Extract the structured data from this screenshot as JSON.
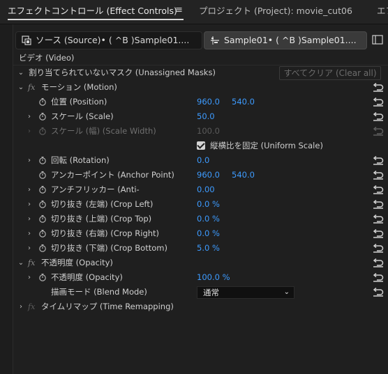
{
  "tabs": {
    "effect_controls": "エフェクトコントロール (Effect Controls)",
    "menu_icon": "≡",
    "project": "プロジェクト (Project): movie_cut06",
    "cut": "エフ"
  },
  "source_bar": {
    "source": "ソース (Source)•  ( ^B )Sample01....",
    "sequence": "Sample01•  ( ^B )Sample01...."
  },
  "section_video": "ビデオ (Video)",
  "unassigned_masks": {
    "label": "割り当てられていないマスク (Unassigned Masks)",
    "clear_all": "すべてクリア (Clear all)"
  },
  "motion": {
    "label": "モーション (Motion)",
    "fx": "fx",
    "position": {
      "label": "位置 (Position)",
      "x": "960.0",
      "y": "540.0"
    },
    "scale": {
      "label": "スケール (Scale)",
      "value": "50.0"
    },
    "scale_width": {
      "label": "スケール (幅) (Scale Width)",
      "value": "100.0"
    },
    "uniform_scale": {
      "label": "縦横比を固定 (Uniform Scale)",
      "checked": true
    },
    "rotation": {
      "label": "回転 (Rotation)",
      "value": "0.0"
    },
    "anchor_point": {
      "label": "アンカーポイント (Anchor Point)",
      "x": "960.0",
      "y": "540.0"
    },
    "anti_flicker": {
      "label": "アンチフリッカー (Anti-",
      "value": "0.00"
    },
    "crop_left": {
      "label": "切り抜き (左端) (Crop Left)",
      "value": "0.0 %"
    },
    "crop_top": {
      "label": "切り抜き (上端) (Crop Top)",
      "value": "0.0 %"
    },
    "crop_right": {
      "label": "切り抜き (右端) (Crop Right)",
      "value": "0.0 %"
    },
    "crop_bottom": {
      "label": "切り抜き (下端) (Crop Bottom)",
      "value": "5.0 %"
    }
  },
  "opacity": {
    "label": "不透明度 (Opacity)",
    "fx": "fx",
    "opacity": {
      "label": "不透明度 (Opacity)",
      "value": "100.0 %"
    },
    "blend_mode": {
      "label": "描画モード (Blend Mode)",
      "value": "通常"
    }
  },
  "time_remapping": {
    "label": "タイムリマップ (Time Remapping)",
    "fx": "fx"
  },
  "colors": {
    "value_blue": "#3d9bff",
    "bg": "#1f1f1f"
  }
}
